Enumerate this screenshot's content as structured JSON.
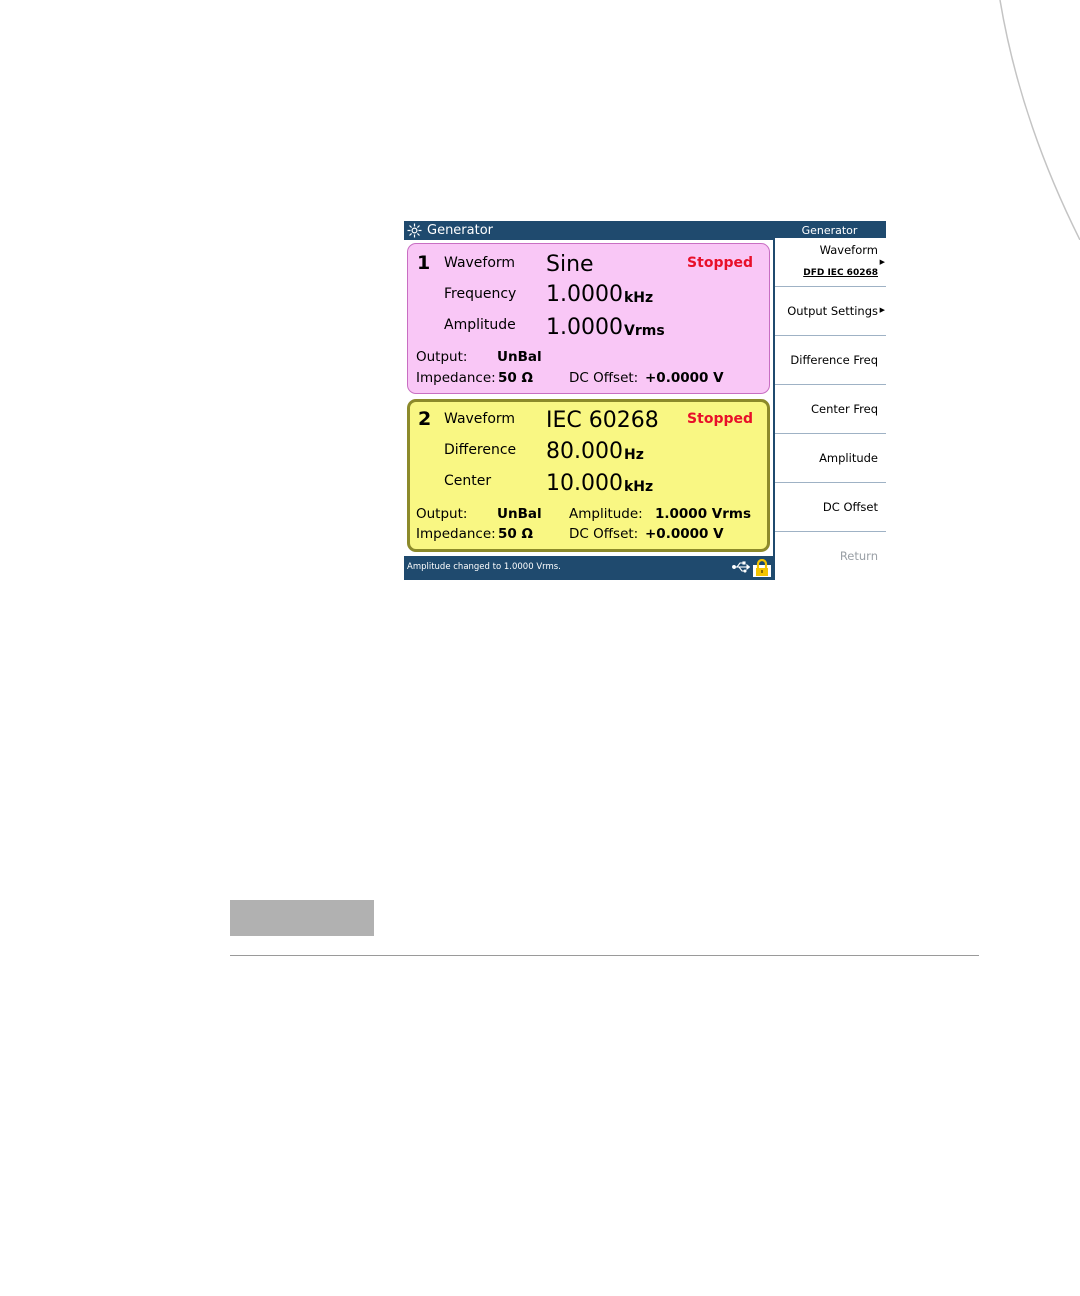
{
  "window": {
    "title": "Generator"
  },
  "channel1": {
    "number": "1",
    "status": "Stopped",
    "rows": [
      {
        "label": "Waveform",
        "value": "Sine",
        "unit": ""
      },
      {
        "label": "Frequency",
        "value": "1.0000",
        "unit": "kHz"
      },
      {
        "label": "Amplitude",
        "value": "1.0000",
        "unit": "Vrms"
      }
    ],
    "output_label": "Output:",
    "output_value": "UnBal",
    "impedance_label": "Impedance:",
    "impedance_value": "50 Ω",
    "dc_offset_label": "DC Offset:",
    "dc_offset_value": "+0.0000 V"
  },
  "channel2": {
    "number": "2",
    "status": "Stopped",
    "rows": [
      {
        "label": "Waveform",
        "value": "IEC 60268",
        "unit": ""
      },
      {
        "label": "Difference",
        "value": "80.000",
        "unit": "Hz"
      },
      {
        "label": "Center",
        "value": "10.000",
        "unit": "kHz"
      }
    ],
    "output_label": "Output:",
    "output_value": "UnBal",
    "amplitude_label": "Amplitude:",
    "amplitude_value": "1.0000 Vrms",
    "impedance_label": "Impedance:",
    "impedance_value": "50 Ω",
    "dc_offset_label": "DC Offset:",
    "dc_offset_value": "+0.0000 V"
  },
  "statusbar": {
    "message": "Amplitude changed to 1.0000 Vrms."
  },
  "softkeys": {
    "title": "Generator",
    "items": [
      {
        "label": "Waveform",
        "sub": "DFD IEC 60268"
      },
      {
        "label": "Output Settings"
      },
      {
        "label": "Difference Freq"
      },
      {
        "label": "Center Freq"
      },
      {
        "label": "Amplitude"
      },
      {
        "label": "DC Offset"
      },
      {
        "label": "Return"
      }
    ]
  },
  "colors": {
    "chrome": "#1f4a6e",
    "channel1_bg": "#f9c7f6",
    "channel2_bg": "#f9f783",
    "status_red": "#e8102a"
  },
  "icons": [
    "generator-icon",
    "usb-icon",
    "lock-icon",
    "submenu-arrow-icon"
  ]
}
